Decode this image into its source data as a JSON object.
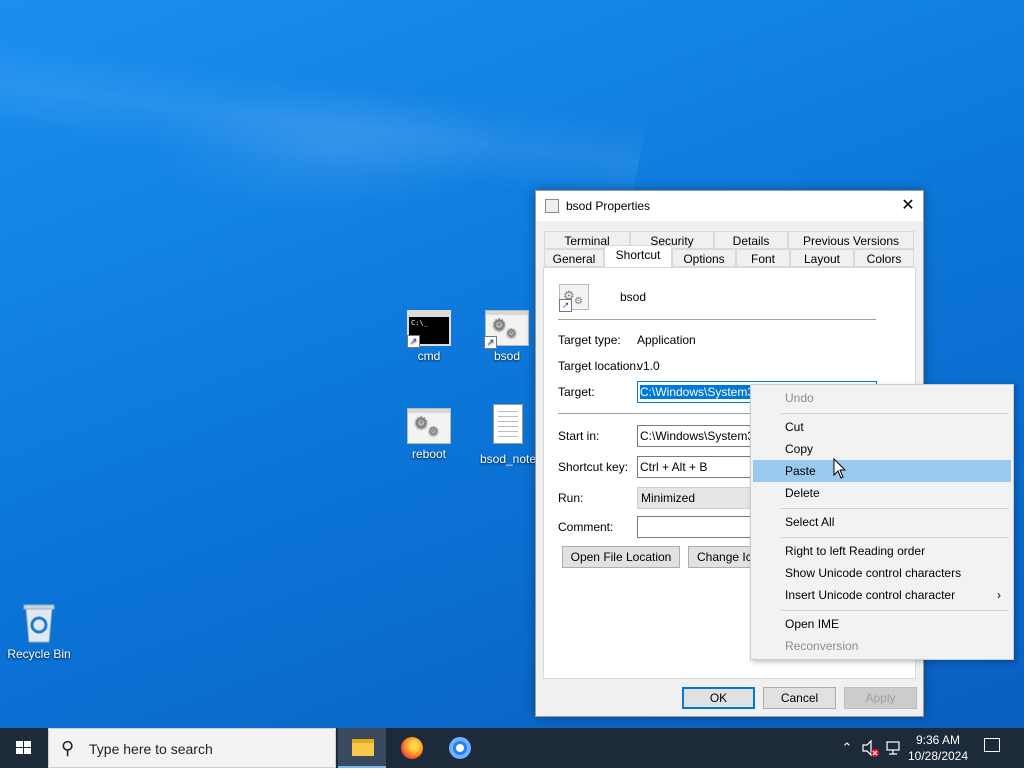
{
  "desktop": {
    "icons": [
      {
        "label": "cmd",
        "type": "cmd"
      },
      {
        "label": "bsod",
        "type": "gear-shortcut"
      },
      {
        "label": "reboot",
        "type": "gear"
      },
      {
        "label": "bsod_note",
        "type": "document"
      },
      {
        "label": "Recycle Bin",
        "type": "recycle-bin"
      }
    ],
    "cmd_prompt_text": "C:\\_"
  },
  "dialog": {
    "title": "bsod Properties",
    "close_label": "✕",
    "tabs_row1": [
      "Terminal",
      "Security",
      "Details",
      "Previous Versions"
    ],
    "tabs_row2": [
      "General",
      "Shortcut",
      "Options",
      "Font",
      "Layout",
      "Colors"
    ],
    "active_tab": "Shortcut",
    "shortcut_name": "bsod",
    "target_type_label": "Target type:",
    "target_type_value": "Application",
    "target_location_label": "Target location:",
    "target_location_value": "v1.0",
    "target_label": "Target:",
    "target_value": "C:\\Windows\\System32",
    "start_in_label": "Start in:",
    "start_in_value": "C:\\Windows\\System32",
    "shortcut_key_label": "Shortcut key:",
    "shortcut_key_value": "Ctrl + Alt + B",
    "run_label": "Run:",
    "run_value": "Minimized",
    "comment_label": "Comment:",
    "comment_value": "",
    "open_file_location": "Open File Location",
    "change_icon": "Change Ico",
    "ok": "OK",
    "cancel": "Cancel",
    "apply": "Apply"
  },
  "context_menu": {
    "undo": "Undo",
    "cut": "Cut",
    "copy": "Copy",
    "paste": "Paste",
    "delete": "Delete",
    "select_all": "Select All",
    "rtl": "Right to left Reading order",
    "show_unicode": "Show Unicode control characters",
    "insert_unicode": "Insert Unicode control character",
    "submenu_arrow": "›",
    "open_ime": "Open IME",
    "reconversion": "Reconversion",
    "hovered_item": "Paste"
  },
  "taskbar": {
    "search_placeholder": "Type here to search",
    "time": "9:36 AM",
    "date": "10/28/2024",
    "apps": [
      "file-explorer",
      "firefox",
      "chrome"
    ]
  },
  "colors": {
    "desktop_blue": "#0a6fd2",
    "selection_blue": "#0078d7",
    "menu_hover": "#99c9ef",
    "taskbar": "#1d2a3a"
  }
}
